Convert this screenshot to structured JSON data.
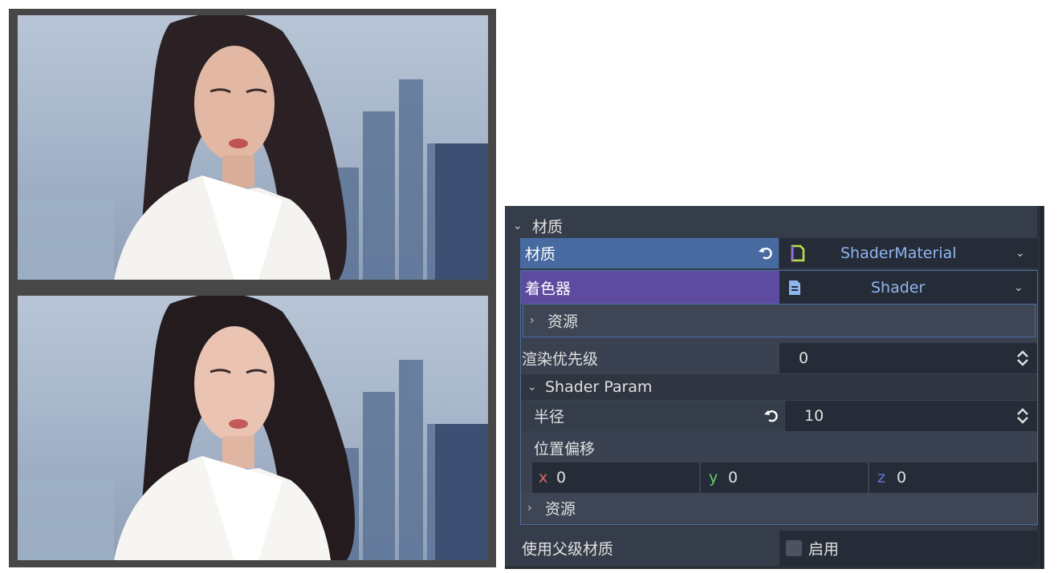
{
  "viewer": {
    "top_image": "oil-painting filtered portrait of a woman with long dark hair in a white blazer, city skyline behind",
    "bottom_image": "original photo portrait of a woman with long dark hair in a white blazer, city skyline behind"
  },
  "inspector": {
    "section_title": "材质",
    "material": {
      "label": "材质",
      "value": "ShaderMaterial",
      "icon": "shader-material-icon",
      "icon_color": "#e0e040"
    },
    "shader": {
      "label": "着色器",
      "value": "Shader",
      "icon": "shader-file-icon"
    },
    "resource_label": "资源",
    "render_priority": {
      "label": "渲染优先级",
      "value": "0"
    },
    "shader_param": {
      "title": "Shader Param",
      "radius": {
        "label": "半径",
        "value": "10"
      },
      "offset": {
        "label": "位置偏移",
        "x_label": "x",
        "x": "0",
        "y_label": "y",
        "y": "0",
        "z_label": "z",
        "z": "0"
      },
      "resource_label": "资源"
    },
    "use_parent_material": {
      "label": "使用父级材质",
      "checkbox_label": "启用",
      "checked": false
    }
  },
  "colors": {
    "material_label_bg": "#476aa0",
    "shader_label_bg": "#5d4ba0",
    "panel_bg": "#363d4a",
    "field_bg": "#262c37",
    "x_axis": "#e06666",
    "y_axis": "#66cc66",
    "z_axis": "#6677dd"
  }
}
